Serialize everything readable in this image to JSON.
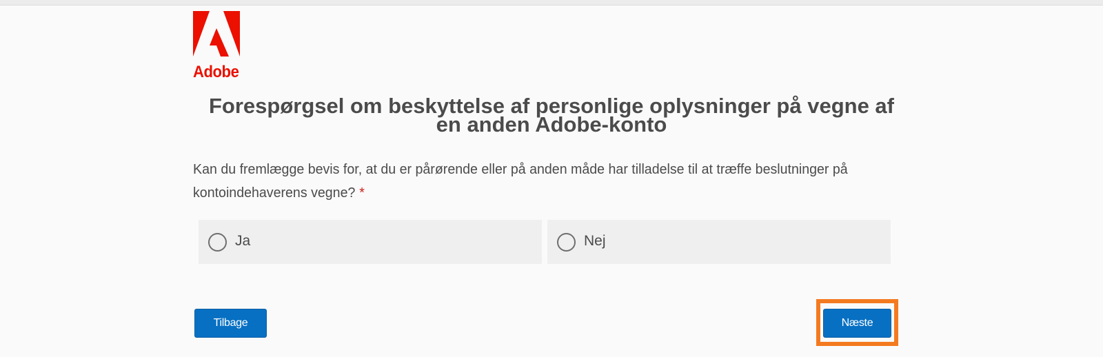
{
  "brand": {
    "name": "Adobe",
    "color": "#EB1000"
  },
  "form": {
    "title": "Forespørgsel om beskyttelse af personlige oplysninger på vegne af en anden Adobe-konto",
    "question": "Kan du fremlægge bevis for, at du er pårørende eller på anden måde har tilladelse til at træffe beslutninger på kontoindehaverens vegne?",
    "required_marker": "*",
    "options": [
      {
        "label": "Ja",
        "selected": false
      },
      {
        "label": "Nej",
        "selected": false
      }
    ]
  },
  "navigation": {
    "back_label": "Tilbage",
    "next_label": "Næste",
    "button_color": "#0770C3",
    "highlight_color": "#F47A20"
  }
}
